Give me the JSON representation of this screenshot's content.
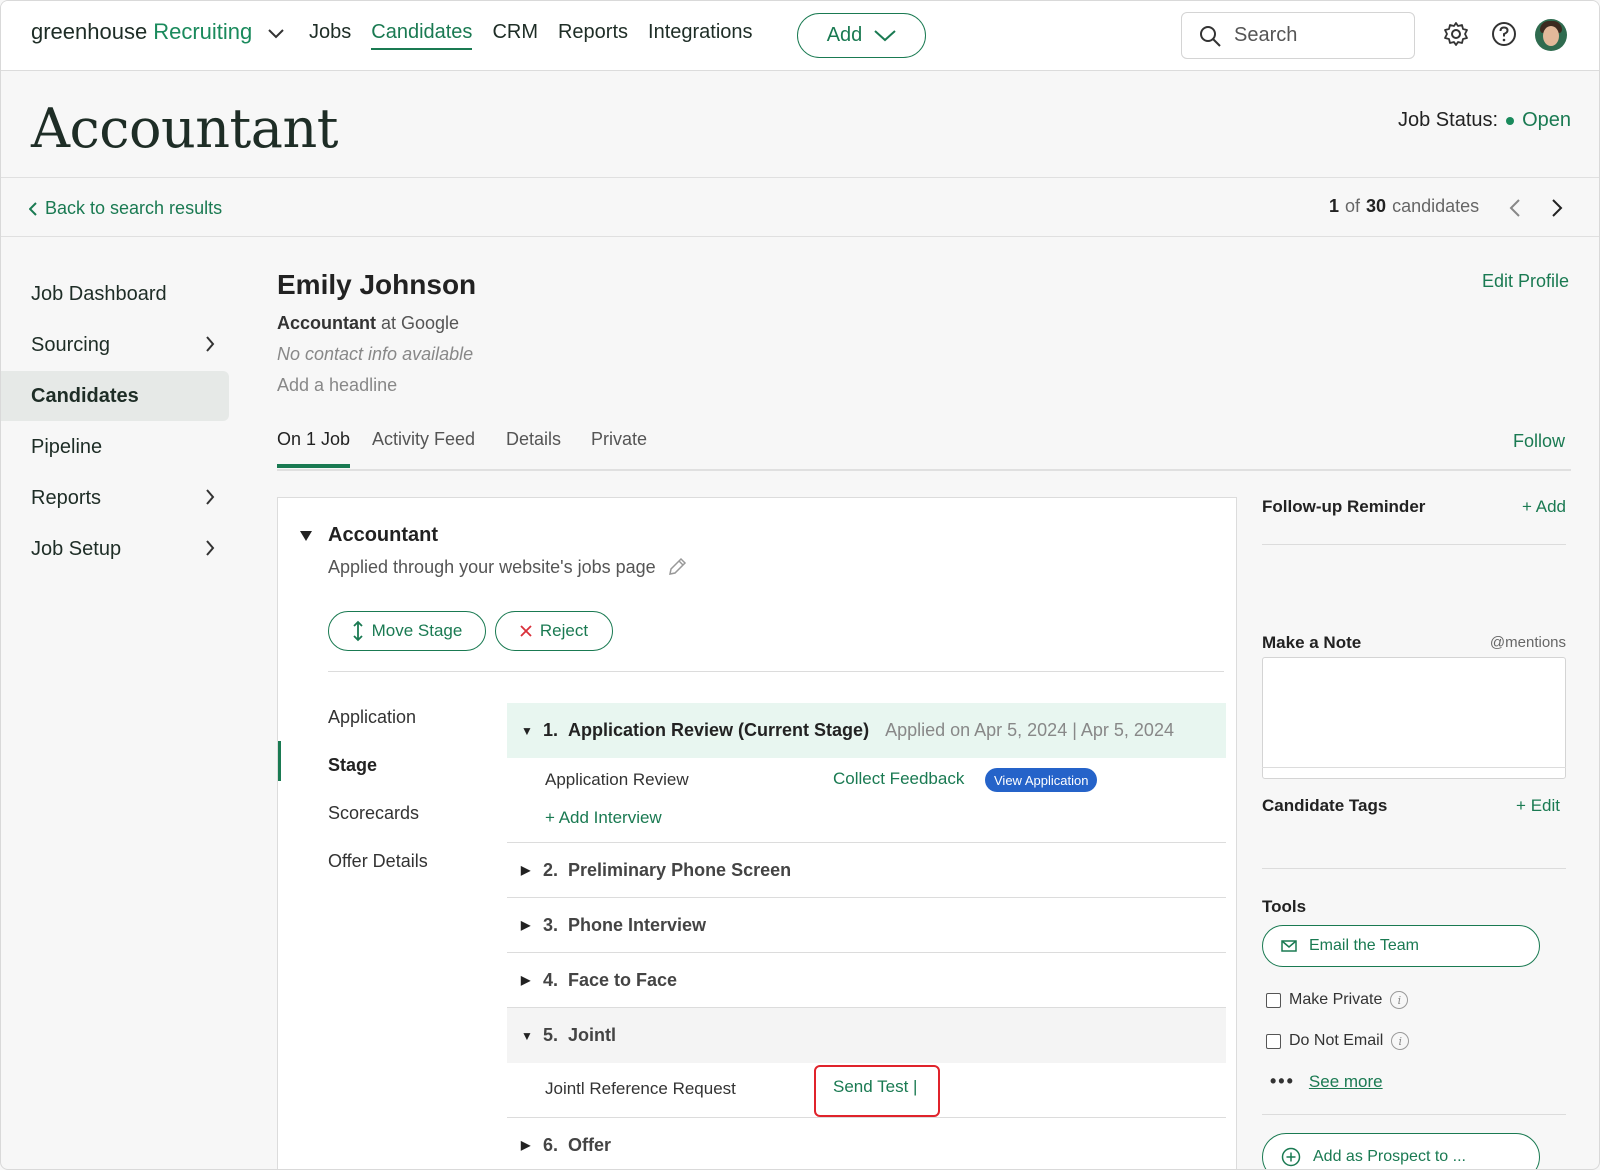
{
  "brand": {
    "part1": "greenhouse",
    "part2": "Recruiting"
  },
  "nav": {
    "jobs": "Jobs",
    "candidates": "Candidates",
    "crm": "CRM",
    "reports": "Reports",
    "integrations": "Integrations"
  },
  "add_label": "Add",
  "search": {
    "placeholder": "Search"
  },
  "job": {
    "title": "Accountant",
    "status_label": "Job Status:",
    "status_value": "Open"
  },
  "back": {
    "label": "Back to search results"
  },
  "pager": {
    "current": "1",
    "of": "of",
    "total": "30",
    "suffix": "candidates"
  },
  "leftnav": {
    "job_dashboard": "Job Dashboard",
    "sourcing": "Sourcing",
    "candidates": "Candidates",
    "pipeline": "Pipeline",
    "reports": "Reports",
    "job_setup": "Job Setup"
  },
  "candidate": {
    "name": "Emily Johnson",
    "role": "Accountant",
    "company_prefix": "at Google",
    "contact": "No contact info available",
    "headline": "Add a headline",
    "edit_profile": "Edit Profile"
  },
  "tabs": {
    "on_job": "On 1 Job",
    "activity": "Activity Feed",
    "details": "Details",
    "private": "Private",
    "follow": "Follow"
  },
  "application": {
    "job_name": "Accountant",
    "source": "Applied through your website's jobs page",
    "move_stage": "Move Stage",
    "reject": "Reject"
  },
  "subnav": {
    "application": "Application",
    "stage": "Stage",
    "scorecards": "Scorecards",
    "offer": "Offer Details"
  },
  "stages": {
    "s1": {
      "num": "1.",
      "name": "Application Review (Current Stage)",
      "meta": "Applied on Apr 5, 2024 | Apr 5, 2024"
    },
    "s1_row": {
      "label": "Application Review",
      "action": "Collect Feedback",
      "badge": "View Application",
      "add": "+ Add Interview"
    },
    "s2": {
      "num": "2.",
      "name": "Preliminary Phone Screen"
    },
    "s3": {
      "num": "3.",
      "name": "Phone Interview"
    },
    "s4": {
      "num": "4.",
      "name": "Face to Face"
    },
    "s5": {
      "num": "5.",
      "name": "Jointl"
    },
    "s5_row": {
      "label": "Jointl Reference Request",
      "action": "Send Test |"
    },
    "s6": {
      "num": "6.",
      "name": "Offer"
    }
  },
  "right": {
    "followup": "Follow-up Reminder",
    "followup_add": "+ Add",
    "note": "Make a Note",
    "mentions": "@mentions",
    "tags": "Candidate Tags",
    "tags_edit": "+ Edit",
    "tools": "Tools",
    "email_team": "Email the Team",
    "make_private": "Make Private",
    "do_not_email": "Do Not Email",
    "info_glyph": "i",
    "see_more": "See more",
    "add_prospect": "Add as Prospect to ..."
  },
  "colors": {
    "accent": "#1a7a52",
    "current_stage_bg": "#e8f6f0",
    "badge": "#2563c9",
    "highlight": "#e0232b"
  }
}
